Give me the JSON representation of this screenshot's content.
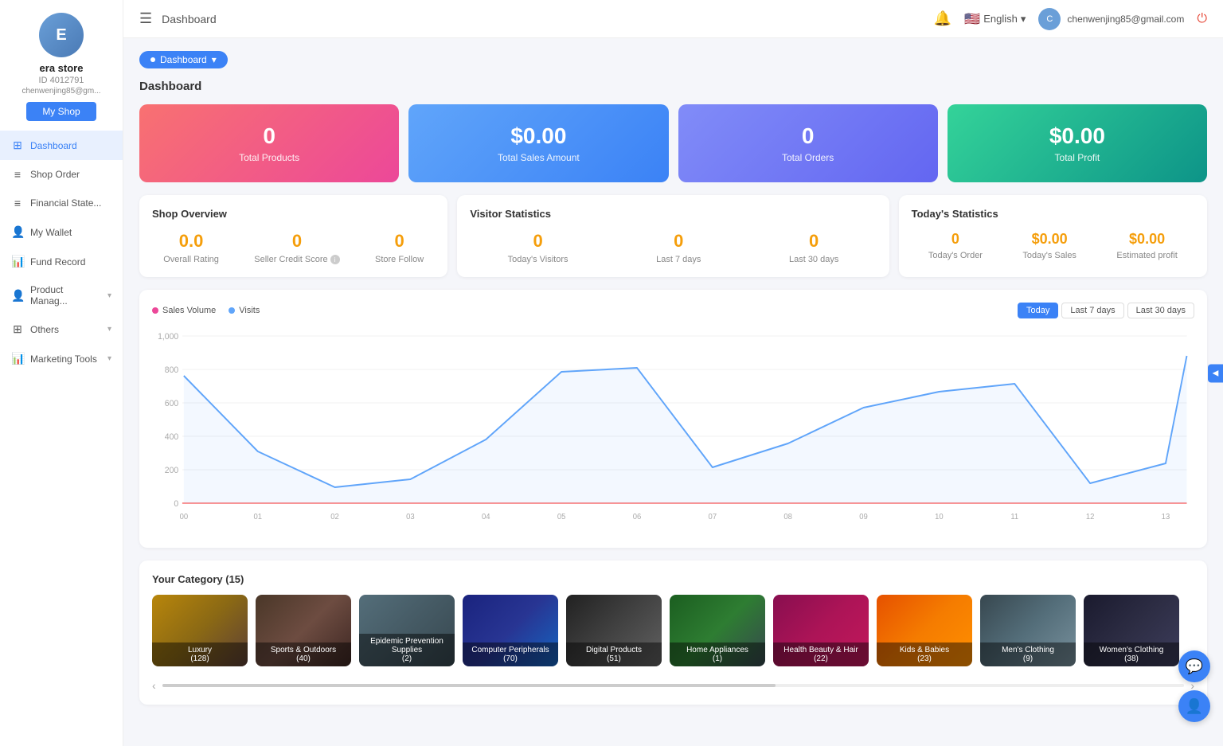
{
  "sidebar": {
    "avatar_initials": "E",
    "store_name": "era store",
    "store_id": "ID 4012791",
    "store_email": "chenwenjing85@gm...",
    "myshop_label": "My Shop",
    "nav_items": [
      {
        "id": "dashboard",
        "icon": "⊞",
        "label": "Dashboard",
        "active": true,
        "has_arrow": false
      },
      {
        "id": "shop-order",
        "icon": "≡",
        "label": "Shop Order",
        "active": false,
        "has_arrow": false
      },
      {
        "id": "financial",
        "icon": "≡",
        "label": "Financial State...",
        "active": false,
        "has_arrow": false
      },
      {
        "id": "my-wallet",
        "icon": "👤",
        "label": "My Wallet",
        "active": false,
        "has_arrow": false
      },
      {
        "id": "fund-record",
        "icon": "📊",
        "label": "Fund Record",
        "active": false,
        "has_arrow": false
      },
      {
        "id": "product-manage",
        "icon": "👤",
        "label": "Product Manag...",
        "active": false,
        "has_arrow": true
      },
      {
        "id": "others",
        "icon": "⊞",
        "label": "Others",
        "active": false,
        "has_arrow": true
      },
      {
        "id": "marketing-tools",
        "icon": "📊",
        "label": "Marketing Tools",
        "active": false,
        "has_arrow": true
      }
    ]
  },
  "topbar": {
    "menu_icon": "☰",
    "title": "Dashboard",
    "lang": "English",
    "user_email": "chenwenjing85@gmail.com",
    "user_initials": "C"
  },
  "breadcrumb": {
    "label": "Dashboard",
    "dot": "●"
  },
  "dashboard": {
    "title": "Dashboard",
    "stat_cards": [
      {
        "id": "total-products",
        "value": "0",
        "label": "Total Products",
        "class": "stat-card-pink"
      },
      {
        "id": "total-sales",
        "value": "$0.00",
        "label": "Total Sales Amount",
        "class": "stat-card-blue"
      },
      {
        "id": "total-orders",
        "value": "0",
        "label": "Total Orders",
        "class": "stat-card-purple"
      },
      {
        "id": "total-profit",
        "value": "$0.00",
        "label": "Total Profit",
        "class": "stat-card-teal"
      }
    ],
    "shop_overview": {
      "title": "Shop Overview",
      "stats": [
        {
          "id": "overall-rating",
          "value": "0.0",
          "label": "Overall Rating"
        },
        {
          "id": "seller-credit",
          "value": "0",
          "label": "Seller Credit Score",
          "has_info": true
        },
        {
          "id": "store-follow",
          "value": "0",
          "label": "Store Follow"
        }
      ]
    },
    "visitor_stats": {
      "title": "Visitor Statistics",
      "stats": [
        {
          "id": "todays-visitors",
          "value": "0",
          "label": "Today's Visitors"
        },
        {
          "id": "last-7-days",
          "value": "0",
          "label": "Last 7 days"
        },
        {
          "id": "last-30-days",
          "value": "0",
          "label": "Last 30 days"
        }
      ]
    },
    "todays_stats": {
      "title": "Today's Statistics",
      "stats": [
        {
          "id": "todays-order",
          "value": "0",
          "label": "Today's Order"
        },
        {
          "id": "todays-sales",
          "value": "$0.00",
          "label": "Today's Sales"
        },
        {
          "id": "estimated-profit",
          "value": "$0.00",
          "label": "Estimated profit"
        }
      ]
    },
    "chart": {
      "legend_sales": "Sales Volume",
      "legend_visits": "Visits",
      "btn_today": "Today",
      "btn_last7": "Last 7 days",
      "btn_last30": "Last 30 days",
      "y_labels": [
        "1,000",
        "800",
        "600",
        "400",
        "200",
        "0"
      ],
      "x_labels": [
        "00",
        "01",
        "02",
        "03",
        "04",
        "05",
        "06",
        "07",
        "08",
        "09",
        "10",
        "11",
        "12",
        "13"
      ],
      "line_points": "30,40 80,220 185,350 285,500 385,390 485,150 585,120 685,460 785,360 885,220 985,180 1085,160 1185,520 1285,460 1355,70"
    },
    "category": {
      "title": "Your Category",
      "count": "(15)",
      "items": [
        {
          "id": "luxury",
          "name": "Luxury",
          "count": "(128)",
          "class": "cat-luxury",
          "icon": "👜"
        },
        {
          "id": "sports",
          "name": "Sports & Outdoors",
          "count": "(40)",
          "class": "cat-sports",
          "icon": "⚽"
        },
        {
          "id": "epidemic",
          "name": "Epidemic Prevention Supplies",
          "count": "(2)",
          "class": "cat-epidemic",
          "icon": "😷"
        },
        {
          "id": "computer",
          "name": "Computer Peripherals",
          "count": "(70)",
          "class": "cat-computer",
          "icon": "💻"
        },
        {
          "id": "digital",
          "name": "Digital Products",
          "count": "(51)",
          "class": "cat-digital",
          "icon": "🎧"
        },
        {
          "id": "home",
          "name": "Home Appliances",
          "count": "(1)",
          "class": "cat-home",
          "icon": "🏠"
        },
        {
          "id": "health",
          "name": "Health Beauty & Hair",
          "count": "(22)",
          "class": "cat-health",
          "icon": "💄"
        },
        {
          "id": "kids",
          "name": "Kids & Babies",
          "count": "(23)",
          "class": "cat-kids",
          "icon": "🧸"
        },
        {
          "id": "mens",
          "name": "Men's Clothing",
          "count": "(9)",
          "class": "cat-mens",
          "icon": "👔"
        },
        {
          "id": "womens",
          "name": "Women's Clothing",
          "count": "(38)",
          "class": "cat-womens",
          "icon": "👗"
        }
      ]
    }
  }
}
